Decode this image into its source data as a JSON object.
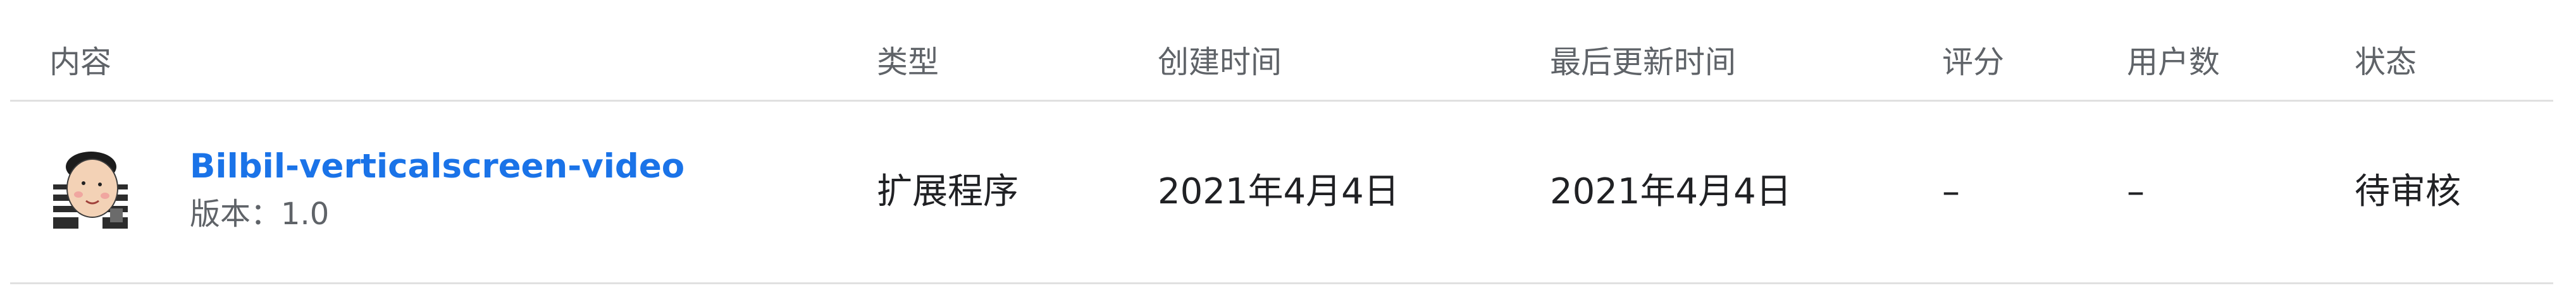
{
  "columns": {
    "content": "内容",
    "type": "类型",
    "created": "创建时间",
    "updated": "最后更新时间",
    "rating": "评分",
    "users": "用户数",
    "status": "状态"
  },
  "row": {
    "icon": "cartoon-avatar-icon",
    "title": "Bilbil-verticalscreen-video",
    "version": "版本：1.0",
    "type": "扩展程序",
    "created": "2021年4月4日",
    "updated": "2021年4月4日",
    "rating": "–",
    "users": "–",
    "status": "待审核"
  },
  "colors": {
    "link": "#1a73e8",
    "header_text": "#5f6368",
    "body_text": "#202124",
    "divider": "#e0e0e0"
  }
}
